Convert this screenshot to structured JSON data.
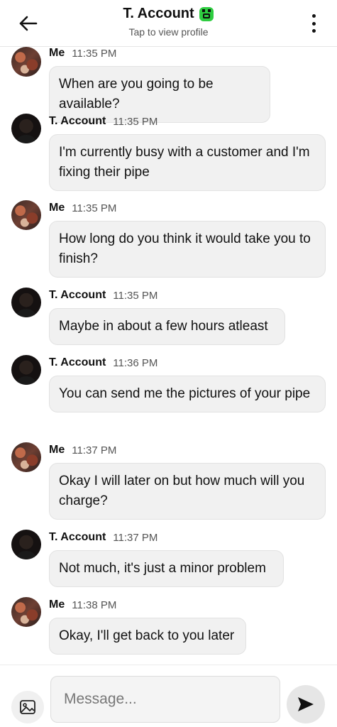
{
  "header": {
    "title": "T. Account",
    "subtitle": "Tap to view profile",
    "back_icon": "arrow-left-icon",
    "badge_icon": "green-alien-emoji-icon",
    "menu_icon": "more-vertical-icon",
    "badge_color": "#2ecc40"
  },
  "messages": [
    {
      "sender": "Me",
      "time": "11:35 PM",
      "text": "When are you going to be available?"
    },
    {
      "sender": "T. Account",
      "time": "11:35 PM",
      "text": "I'm currently busy with a customer and I'm fixing their pipe"
    },
    {
      "sender": "Me",
      "time": "11:35 PM",
      "text": "How long do you think it would take you to finish?"
    },
    {
      "sender": "T. Account",
      "time": "11:35 PM",
      "text": "Maybe in about a few hours atleast"
    },
    {
      "sender": "T. Account",
      "time": "11:36 PM",
      "text": "You can send me the pictures of your pipe"
    },
    {
      "sender": "Me",
      "time": "11:37 PM",
      "text": "Okay I will later on but how much will you charge?"
    },
    {
      "sender": "T. Account",
      "time": "11:37 PM",
      "text": "Not much, it's just a minor problem"
    },
    {
      "sender": "Me",
      "time": "11:38 PM",
      "text": "Okay, I'll get back to you later"
    }
  ],
  "composer": {
    "placeholder": "Message...",
    "gallery_icon": "image-icon",
    "send_icon": "send-icon"
  }
}
